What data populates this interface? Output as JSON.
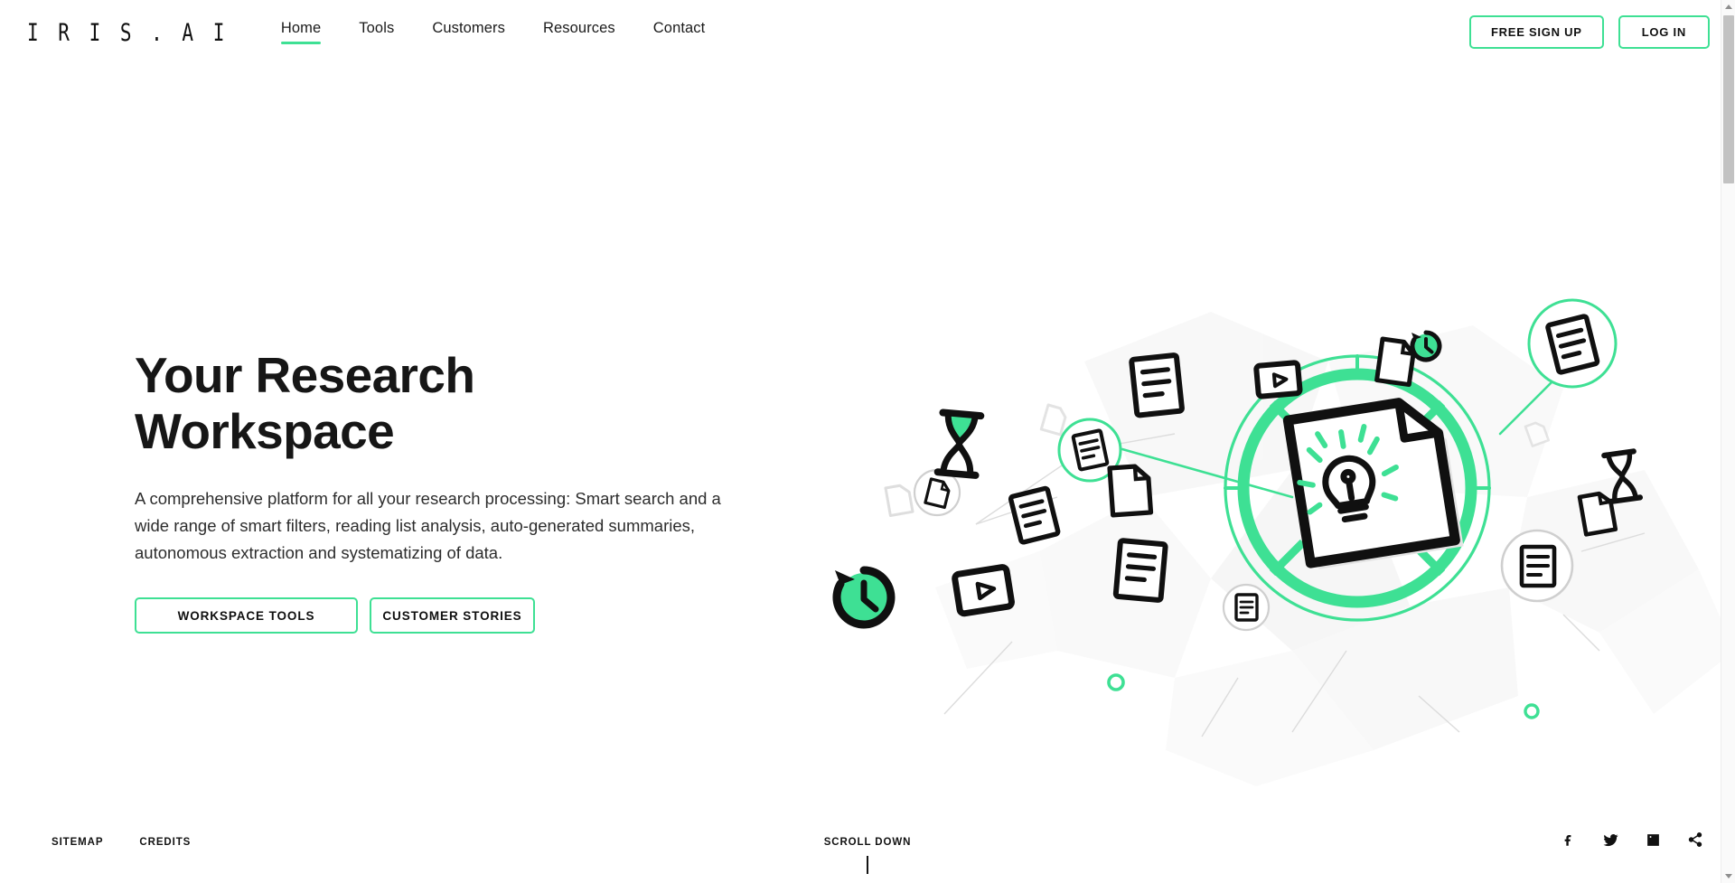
{
  "header": {
    "logo_text": "I R I S . A I",
    "logo_name": "iris-ai-logo",
    "nav": [
      {
        "label": "Home",
        "active": true
      },
      {
        "label": "Tools",
        "active": false
      },
      {
        "label": "Customers",
        "active": false
      },
      {
        "label": "Resources",
        "active": false
      },
      {
        "label": "Contact",
        "active": false
      }
    ],
    "signup_label": "FREE SIGN UP",
    "login_label": "LOG IN"
  },
  "hero": {
    "title_line1": "Your Research",
    "title_line2": "Workspace",
    "subtitle": "A comprehensive platform for all your research processing: Smart search and a wide range of smart filters, reading list analysis, auto-generated summaries, autonomous extraction and systematizing of data.",
    "cta_primary": "WORKSPACE TOOLS",
    "cta_secondary": "CUSTOMER STORIES"
  },
  "illustration": {
    "center_icon": "document-with-lightbulb-icon",
    "ring": "green-dial-ring",
    "nodes": [
      "document-lines-icon",
      "document-blank-icon",
      "video-play-icon",
      "hourglass-icon",
      "clock-history-icon"
    ]
  },
  "footer": {
    "links": [
      {
        "label": "SITEMAP"
      },
      {
        "label": "CREDITS"
      }
    ],
    "scroll_label": "SCROLL DOWN",
    "social": [
      {
        "name": "facebook-icon",
        "label": "Facebook"
      },
      {
        "name": "twitter-icon",
        "label": "Twitter"
      },
      {
        "name": "linkedin-icon",
        "label": "LinkedIn"
      },
      {
        "name": "share-icon",
        "label": "Share"
      }
    ]
  },
  "colors": {
    "accent_green": "#3ee094",
    "accent_green_deep": "#1fd67f",
    "ink": "#141414",
    "background": "#ffffff",
    "muted_gray": "#f4f4f4"
  }
}
